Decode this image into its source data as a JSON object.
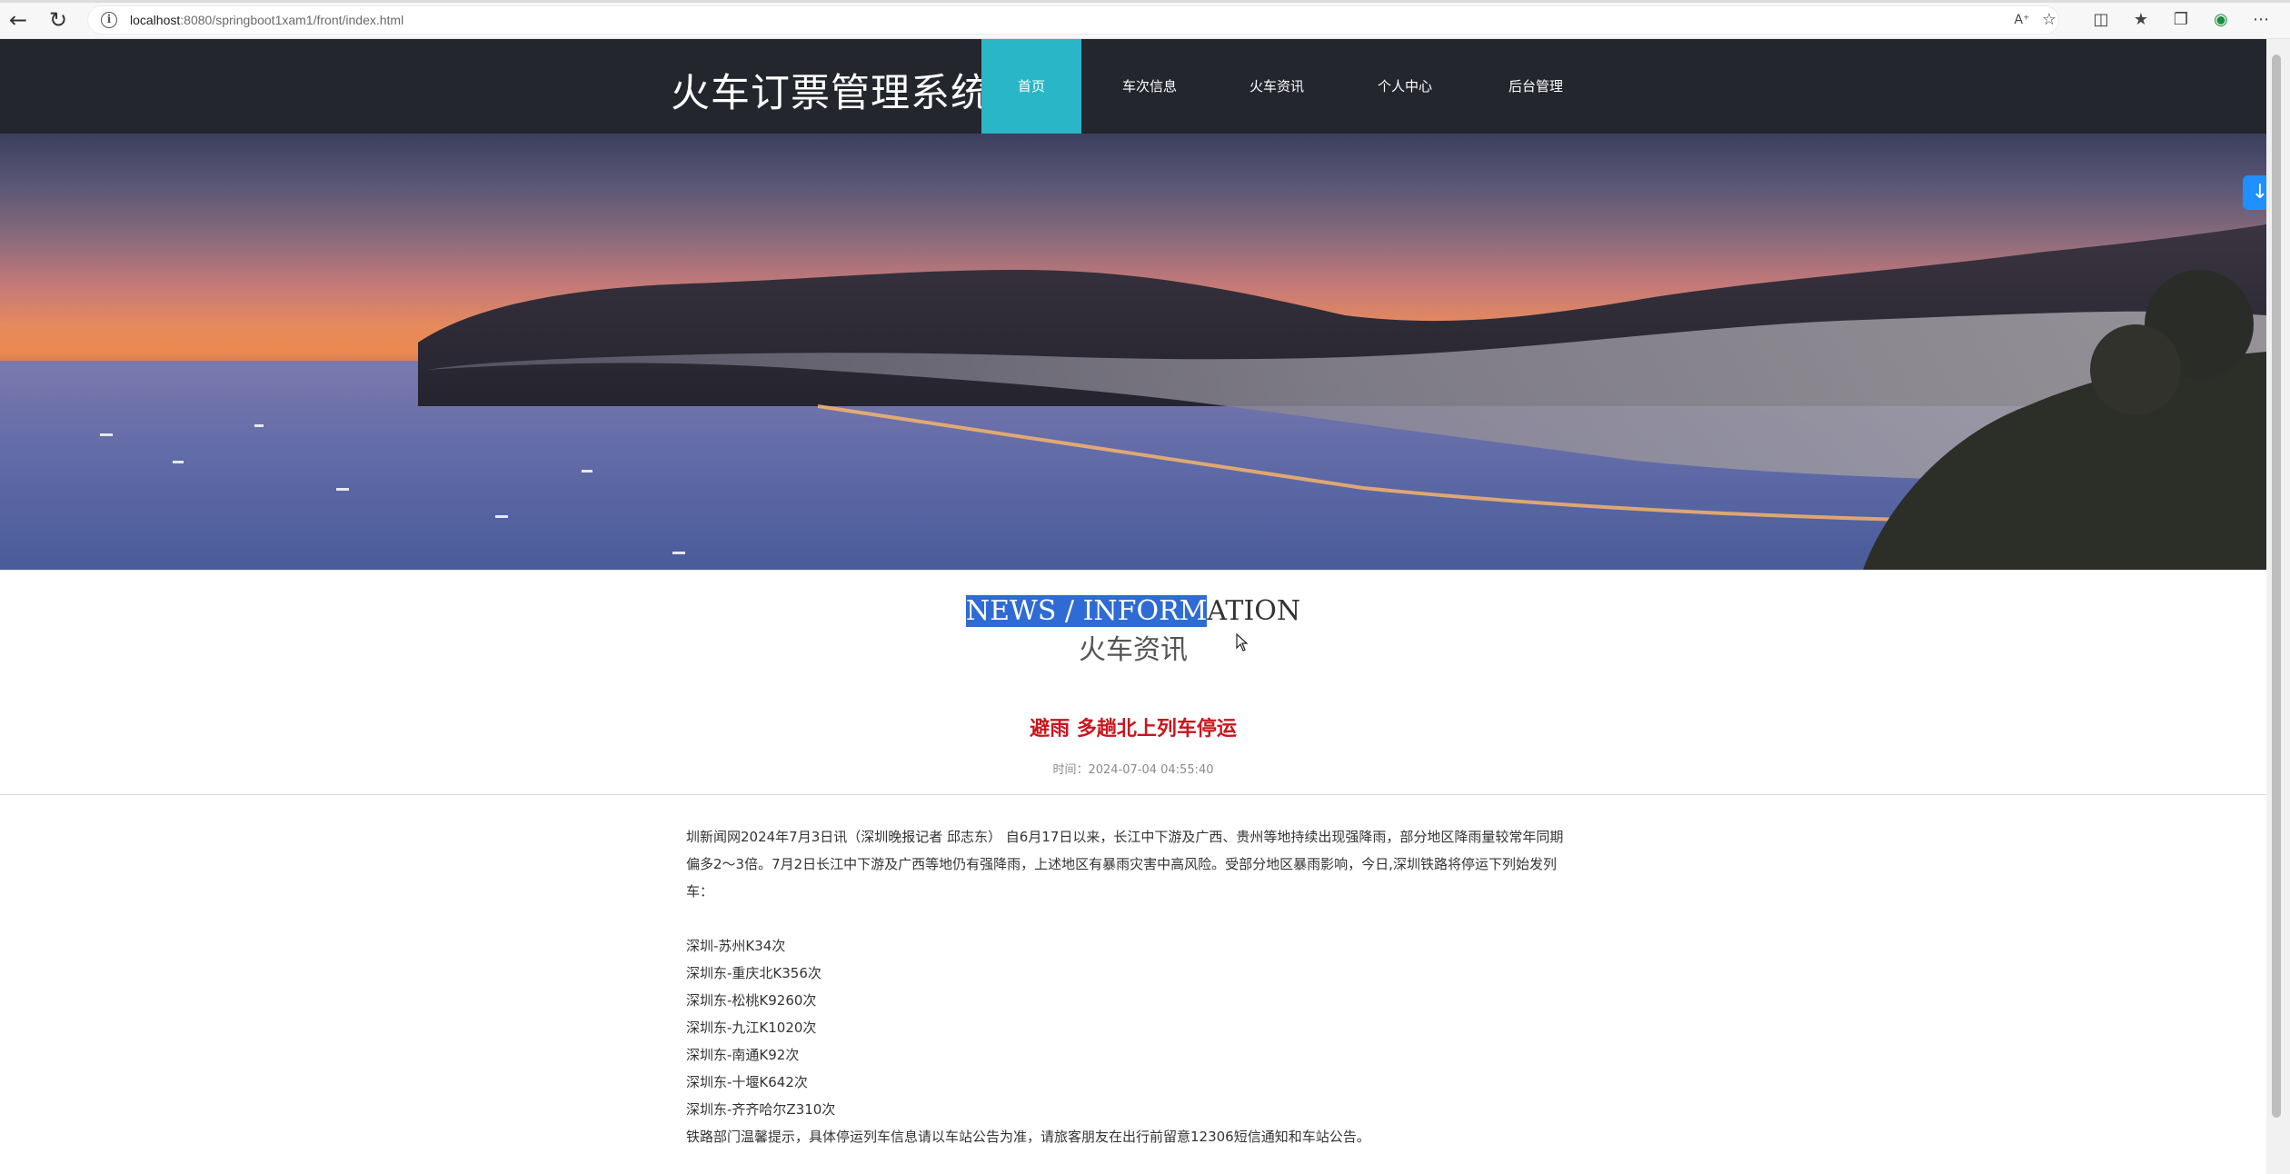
{
  "browser": {
    "url_host": "localhost",
    "url_rest": ":8080/springboot1xam1/front/index.html"
  },
  "header": {
    "site_title": "火车订票管理系统",
    "nav": [
      {
        "label": "首页",
        "active": true
      },
      {
        "label": "车次信息",
        "active": false
      },
      {
        "label": "火车资讯",
        "active": false
      },
      {
        "label": "个人中心",
        "active": false
      },
      {
        "label": "后台管理",
        "active": false
      }
    ]
  },
  "colors": {
    "header_bg": "#23262c",
    "nav_active": "#29b6c6",
    "article_title": "#c8161d",
    "selection": "#2f6bd4"
  },
  "section": {
    "title_en_selected": "NEWS / INFORM",
    "title_en_rest": "ATION",
    "title_cn": "火车资讯"
  },
  "article": {
    "title": "避雨 多趟北上列车停运",
    "time": "时间：2024-07-04 04:55:40",
    "intro": "圳新闻网2024年7月3日讯（深圳晚报记者 邱志东） 自6月17日以来，长江中下游及广西、贵州等地持续出现强降雨，部分地区降雨量较常年同期偏多2～3倍。7月2日长江中下游及广西等地仍有强降雨，上述地区有暴雨灾害中高风险。受部分地区暴雨影响，今日,深圳铁路将停运下列始发列车：",
    "trains": [
      "深圳-苏州K34次",
      "深圳东-重庆北K356次",
      "深圳东-松桃K9260次",
      "深圳东-九江K1020次",
      "深圳东-南通K92次",
      "深圳东-十堰K642次",
      "深圳东-齐齐哈尔Z310次"
    ],
    "notice": "铁路部门温馨提示，具体停运列车信息请以车站公告为准，请旅客朋友在出行前留意12306短信通知和车站公告。"
  }
}
